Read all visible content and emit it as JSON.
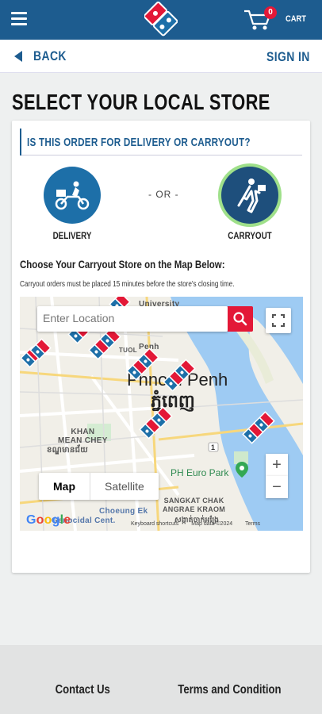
{
  "header": {
    "cart_count": "0",
    "cart_label": "CART",
    "brand_color": "#1d5c8f",
    "accent_color": "#e31837"
  },
  "nav": {
    "back_label": "BACK",
    "signin_label": "SIGN IN"
  },
  "page": {
    "title": "SELECT YOUR LOCAL STORE",
    "question": "IS THIS ORDER FOR DELIVERY OR CARRYOUT?",
    "options": [
      {
        "label": "DELIVERY",
        "icon": "delivery-scooter-icon",
        "selected": false
      },
      {
        "label": "CARRYOUT",
        "icon": "carryout-person-icon",
        "selected": true
      }
    ],
    "or_label": "- OR -",
    "choose_heading": "Choose Your Carryout Store on the Map Below:",
    "note": "Carryout orders must be placed 15 minutes before the store's closing time."
  },
  "map": {
    "search_placeholder": "Enter Location",
    "map_type_options": [
      "Map",
      "Satellite"
    ],
    "selected_map_type": "Map",
    "city_name": "Phnom Penh",
    "city_name_kh": "ភ្នំពេញ",
    "district_label": "KHAN\nMEAN CHEY",
    "district_label_kh": "ខណ្ឌមានជ័យ",
    "labels": {
      "university": "University",
      "tuol": "TUOL",
      "choeung_ek": "Choeung Ek",
      "genocidal": "Genocidal Cent.",
      "chak_angre": "SANGKAT CHAK\nANGRAE KRAOM",
      "chak_angre_kh": "សង្កាត់ចាក់អង្រែ",
      "road_number": "1",
      "euro_park": "PH Euro Park",
      "penh": "Penh"
    },
    "google_label": "Google",
    "attribution": [
      "Keyboard shortcuts",
      "Map data ©2024",
      "Terms"
    ],
    "store_pin_count": 11
  },
  "footer": {
    "links": [
      "Contact Us",
      "Terms and Condition"
    ]
  }
}
